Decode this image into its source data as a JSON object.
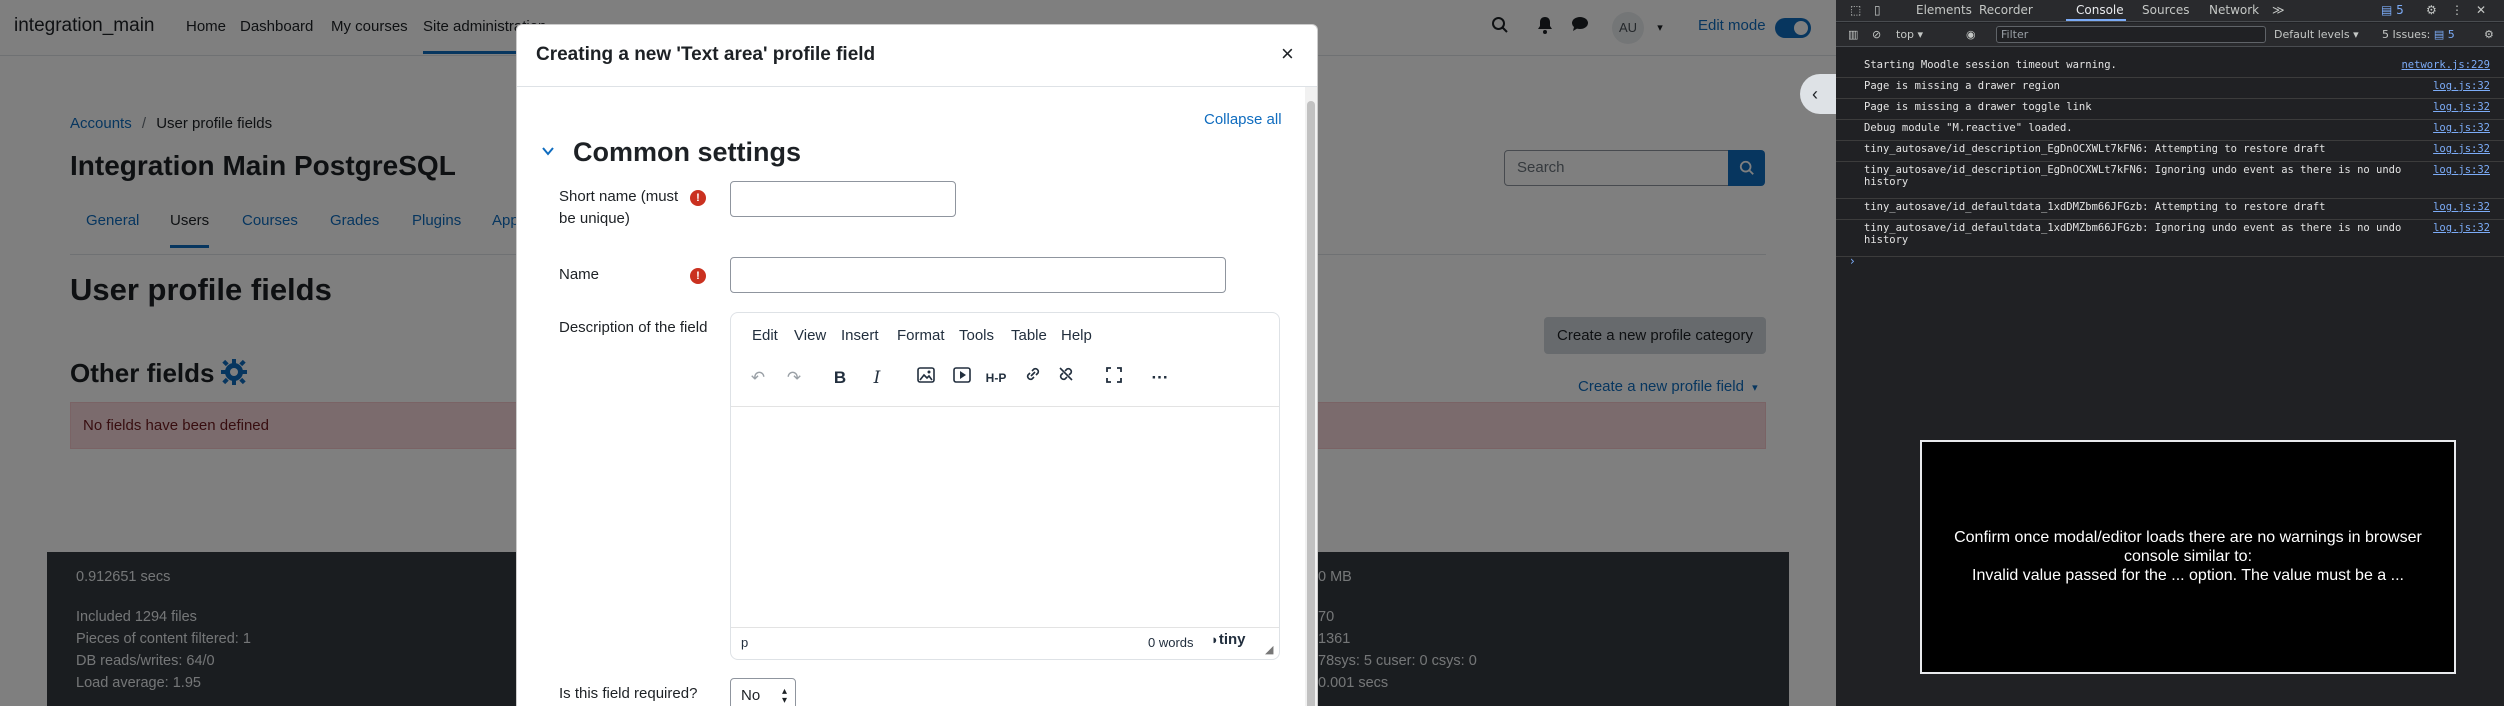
{
  "navbar": {
    "brand": "integration_main",
    "links": [
      "Home",
      "Dashboard",
      "My courses",
      "Site administration"
    ],
    "avatar": "AU",
    "edit_mode": "Edit mode"
  },
  "breadcrumb": [
    "Accounts",
    "User profile fields"
  ],
  "page_title": "Integration Main PostgreSQL",
  "search_placeholder": "Search",
  "tabs": [
    "General",
    "Users",
    "Courses",
    "Grades",
    "Plugins",
    "App"
  ],
  "heading": "User profile fields",
  "create_category": "Create a new profile category",
  "other_fields": "Other fields",
  "create_field": "Create a new profile field",
  "no_fields": "No fields have been defined",
  "footer": {
    "time": "0.912651 secs",
    "files": "Included 1294 files",
    "filtered": "Pieces of content filtered: 1",
    "db": "DB reads/writes: 64/0",
    "load": "Load average: 1.95",
    "mem": "0 MB",
    "r2": "70",
    "r3": "1361",
    "r4": "78sys: 5 cuser: 0 csys: 0",
    "r5": "0.001 secs"
  },
  "modal": {
    "title": "Creating a new 'Text area' profile field",
    "collapse_all": "Collapse all",
    "section": "Common settings",
    "short_name_label": "Short name (must be unique)",
    "name_label": "Name",
    "description_label": "Description of the field",
    "required_label": "Is this field required?",
    "required_value": "No",
    "editor_menu": [
      "Edit",
      "View",
      "Insert",
      "Format",
      "Tools",
      "Table",
      "Help"
    ],
    "editor_path": "p",
    "editor_words": "0 words",
    "editor_brand": "tiny"
  },
  "devtools": {
    "tabs": [
      "Elements",
      "Recorder",
      "Console",
      "Sources",
      "Network"
    ],
    "issues_badge": "5",
    "context": "top",
    "filter_placeholder": "Filter",
    "levels": "Default levels",
    "issues": "5 Issues:",
    "issues_count": "5",
    "logs": [
      {
        "msg": "Starting Moodle session timeout warning.",
        "src": "network.js:229"
      },
      {
        "msg": "Page is missing a drawer region",
        "src": "log.js:32"
      },
      {
        "msg": "Page is missing a drawer toggle link",
        "src": "log.js:32"
      },
      {
        "msg": "Debug module \"M.reactive\" loaded.",
        "src": "log.js:32"
      },
      {
        "msg": "tiny_autosave/id_description_EgDnOCXWLt7kFN6: Attempting to restore draft",
        "src": "log.js:32"
      },
      {
        "msg": "tiny_autosave/id_description_EgDnOCXWLt7kFN6: Ignoring undo event as there is no undo history",
        "src": "log.js:32"
      },
      {
        "msg": "tiny_autosave/id_defaultdata_1xdDMZbm66JFGzb: Attempting to restore draft",
        "src": "log.js:32"
      },
      {
        "msg": "tiny_autosave/id_defaultdata_1xdDMZbm66JFGzb: Ignoring undo event as there is no undo history",
        "src": "log.js:32"
      }
    ]
  },
  "note": {
    "line1": "Confirm once modal/editor loads there are no warnings in browser",
    "line2": "console similar to:",
    "line3": "Invalid value passed for the ... option. The value must be a ..."
  }
}
